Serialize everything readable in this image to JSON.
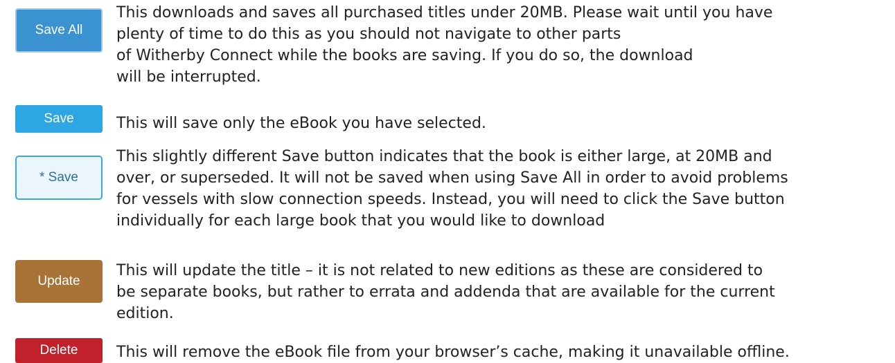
{
  "rows": [
    {
      "button_label": "Save All",
      "description": [
        "This downloads and saves all purchased titles under 20MB. Please wait until you have",
        "plenty of time to do this as you should not navigate to other parts",
        "of Witherby Connect while the books are saving. If you do so, the download",
        "will be interrupted."
      ]
    },
    {
      "button_label": "Save",
      "description": [
        "This will save only the eBook you have selected."
      ]
    },
    {
      "button_label": "* Save",
      "description": [
        "This slightly different Save button indicates that the book is either large, at 20MB and",
        "over, or superseded. It will not be saved when using Save All in order to avoid problems",
        "for vessels with slow connection speeds. Instead, you will need to click the Save button",
        "individually for each large book that you would like to download"
      ]
    },
    {
      "button_label": "Update",
      "description": [
        "This will update the title – it is not related to new editions as these are considered to",
        "be separate books, but rather to errata and addenda that are available for the current",
        "edition."
      ]
    },
    {
      "button_label": "Delete",
      "description": [
        "This will remove the eBook file from your browser’s cache, making it unavailable offline."
      ]
    }
  ],
  "colors": {
    "save_all": "#3a93d0",
    "save": "#2fa6e4",
    "star_save_bg": "#eaf6fc",
    "star_save_border": "#3aa7e0",
    "update": "#a77336",
    "delete": "#c0212a"
  }
}
